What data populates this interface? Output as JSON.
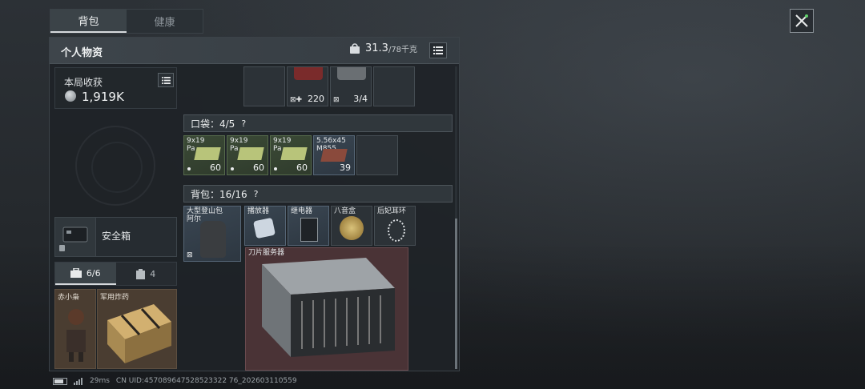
{
  "tabs": [
    {
      "label": "背包",
      "active": true
    },
    {
      "label": "健康",
      "active": false
    }
  ],
  "panel": {
    "title": "个人物资",
    "weight_value": "31.3",
    "weight_max": "/78千克"
  },
  "harvest": {
    "label": "本局收获",
    "value": "1,919K"
  },
  "safebox": {
    "label": "安全箱"
  },
  "subtabs": [
    {
      "label": "6/6",
      "icon": "briefcase-icon",
      "active": true
    },
    {
      "label": "4",
      "icon": "clipboard-icon",
      "active": false
    }
  ],
  "equip": [
    {
      "label": "赤小枭"
    },
    {
      "label": "军用炸药"
    }
  ],
  "top_items": [
    {
      "count": "220",
      "icon": "medkit-icon"
    },
    {
      "count": "3/4",
      "icon": "first-aid-icon"
    }
  ],
  "pocket": {
    "label": "口袋：4/5",
    "help": "?",
    "items": [
      {
        "line1": "9x19",
        "line2": "Pa",
        "count": "60",
        "kind": "green"
      },
      {
        "line1": "9x19",
        "line2": "Pa",
        "count": "60",
        "kind": "green"
      },
      {
        "line1": "9x19",
        "line2": "Pa",
        "count": "60",
        "kind": "green"
      },
      {
        "line1": "5.56x45",
        "line2": "M855",
        "count": "39",
        "kind": "blue"
      }
    ]
  },
  "backpack": {
    "label": "背包：16/16",
    "help": "?",
    "items": [
      {
        "line1": "大型登山包",
        "line2": "阿尔",
        "kind": "blue"
      },
      {
        "line1": "播放器",
        "kind": "blue"
      },
      {
        "line1": "继电器",
        "kind": "blue"
      },
      {
        "line1": "八音盒",
        "kind": "plain"
      },
      {
        "line1": "后妃耳环",
        "kind": "plain"
      },
      {
        "line1": "刀片服务器",
        "kind": "red"
      }
    ]
  },
  "footer": {
    "ping": "29ms",
    "uid": "CN UID:457089647528523322 76_202603110559"
  },
  "colors": {
    "accent": "#d6d9dc",
    "green_item": "#3b4a36",
    "blue_item": "#3a4652",
    "red_item": "#4a3336"
  }
}
